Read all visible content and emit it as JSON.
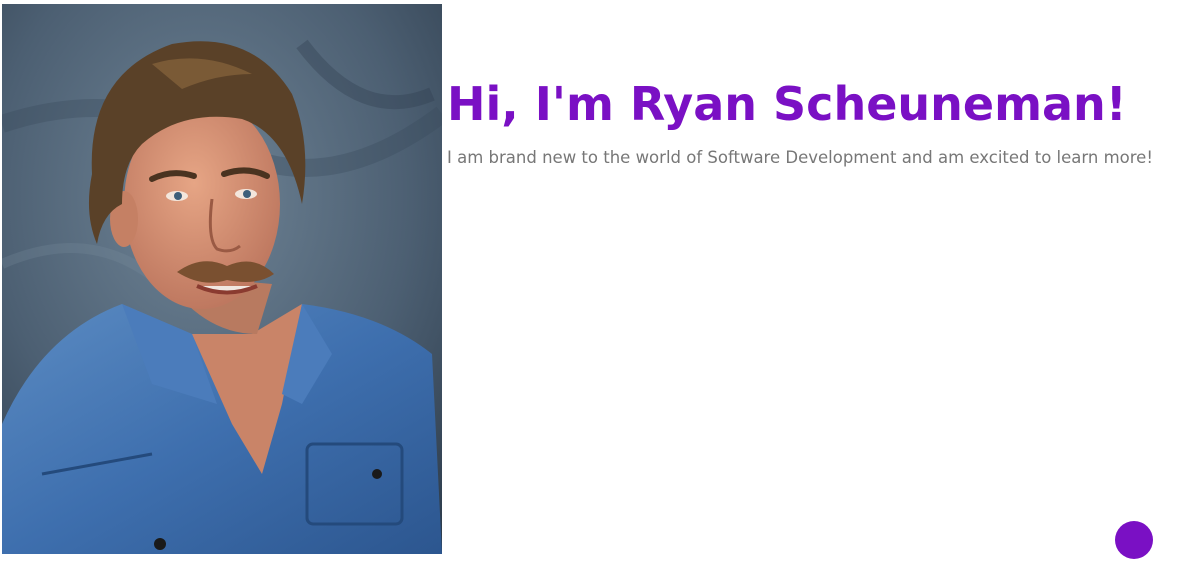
{
  "profile": {
    "photo_icon": "portrait-photo",
    "heading": "Hi, I'm Ryan Scheuneman!",
    "intro_text": "I am brand new to the world of Software Development and am excited to learn more!"
  },
  "floating_button": {
    "icon": "circle-button"
  },
  "colors": {
    "accent": "#7a10c4",
    "body_text": "#777777",
    "background": "#ffffff"
  }
}
